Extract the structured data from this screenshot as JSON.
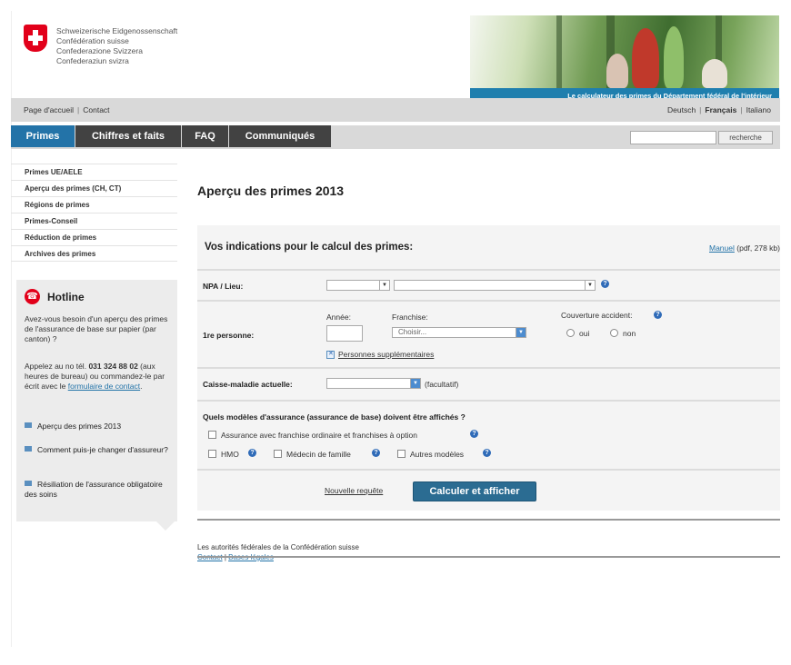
{
  "header": {
    "confederation": [
      "Schweizerische Eidgenossenschaft",
      "Confédération suisse",
      "Confederazione Svizzera",
      "Confederaziun svizra"
    ],
    "banner_caption": "Le calculateur des primes du Département fédéral de l'intérieur"
  },
  "metabar": {
    "home": "Page d'accueil",
    "sep": "|",
    "contact": "Contact",
    "languages": [
      "Deutsch",
      "Français",
      "Italiano"
    ]
  },
  "nav": {
    "tabs": [
      "Primes",
      "Chiffres et faits",
      "FAQ",
      "Communiqués"
    ],
    "search_button": "recherche",
    "search_placeholder": ""
  },
  "sidebar": {
    "items": [
      "Primes UE/AELE",
      "Aperçu des primes (CH, CT)",
      "Régions de primes",
      "Primes-Conseil",
      "Réduction de primes",
      "Archives des primes"
    ]
  },
  "hotline": {
    "title": "Hotline",
    "intro": "Avez-vous besoin d'un aperçu des primes de l'assurance de base sur papier (par canton) ?",
    "call_prefix": "Appelez au no tél.",
    "phone": "031 324 88 02",
    "call_suffix": "(aux heures de bureau) ou commandez-le par écrit avec le",
    "form_link": "formulaire de contact",
    "period": ".",
    "links": [
      "Aperçu des primes 2013",
      "Comment puis-je changer d'assureur?",
      "Résiliation de l'assurance obligatoire des soins"
    ]
  },
  "content": {
    "title": "Aperçu des primes 2013",
    "panel_title": "Vos indications pour le calcul des primes:",
    "manual_link": "Manuel",
    "manual_info": "(pdf, 278 kb)",
    "npa_label": "NPA / Lieu:",
    "person_label": "1re personne:",
    "year_label": "Année:",
    "franchise_label": "Franchise:",
    "franchise_value": "Choisir...",
    "coverage_label": "Couverture accident:",
    "yes": "oui",
    "no": "non",
    "more_persons": "Personnes supplémentaires",
    "insurer_label": "Caisse-maladie actuelle:",
    "optional": "(facultatif)",
    "models_question": "Quels modèles d'assurance (assurance de base) doivent être affichés ?",
    "opt_franchise": "Assurance avec franchise ordinaire et franchises à option",
    "opt_hmo": "HMO",
    "opt_family": "Médecin de famille",
    "opt_other": "Autres modèles",
    "new_request": "Nouvelle requête",
    "calc_button": "Calculer et afficher",
    "info_glyph": "?",
    "arrow_glyph": "▼"
  },
  "footer": {
    "authorities": "Les autorités fédérales de la Confédération suisse",
    "contact": "Contact",
    "sep": "|",
    "legal": "Bases légales"
  },
  "colors": {
    "swiss_red": "#e2001a",
    "nav_blue": "#2373a8",
    "nav_dark": "#424242",
    "button": "#2b6c92"
  }
}
